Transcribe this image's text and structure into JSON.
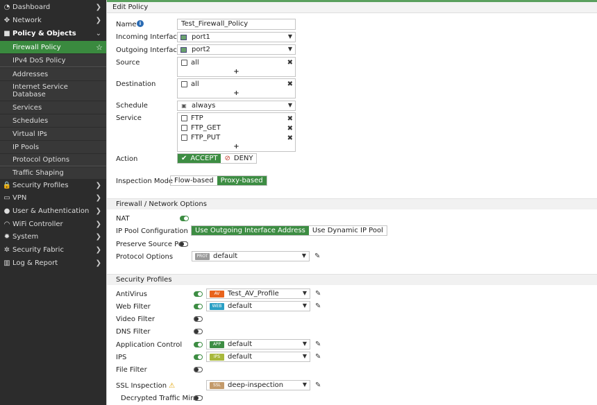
{
  "sidebar": {
    "items": [
      {
        "icon": "dashboard-icon",
        "glyph": "◔",
        "label": "Dashboard"
      },
      {
        "icon": "network-icon",
        "glyph": "✥",
        "label": "Network"
      },
      {
        "icon": "policy-icon",
        "glyph": "■",
        "label": "Policy & Objects"
      },
      {
        "icon": "security-profiles-icon",
        "glyph": "🔒",
        "label": "Security Profiles"
      },
      {
        "icon": "vpn-icon",
        "glyph": "▭",
        "label": "VPN"
      },
      {
        "icon": "user-icon",
        "glyph": "●",
        "label": "User & Authentication"
      },
      {
        "icon": "wifi-icon",
        "glyph": "◠",
        "label": "WiFi Controller"
      },
      {
        "icon": "system-icon",
        "glyph": "✹",
        "label": "System"
      },
      {
        "icon": "security-fabric-icon",
        "glyph": "✲",
        "label": "Security Fabric"
      },
      {
        "icon": "log-report-icon",
        "glyph": "▥",
        "label": "Log & Report"
      }
    ],
    "sub_items": [
      "Firewall Policy",
      "IPv4 DoS Policy",
      "Addresses",
      "Internet Service Database",
      "Services",
      "Schedules",
      "Virtual IPs",
      "IP Pools",
      "Protocol Options",
      "Traffic Shaping"
    ],
    "accent": "#3a8a3f"
  },
  "header": {
    "title": "Edit Policy"
  },
  "form": {
    "name_label": "Name",
    "name_value": "Test_Firewall_Policy",
    "incoming_label": "Incoming Interface",
    "incoming_value": "port1",
    "outgoing_label": "Outgoing Interface",
    "outgoing_value": "port2",
    "source_label": "Source",
    "source_value": "all",
    "destination_label": "Destination",
    "destination_value": "all",
    "schedule_label": "Schedule",
    "schedule_value": "always",
    "service_label": "Service",
    "services": [
      "FTP",
      "FTP_GET",
      "FTP_PUT"
    ],
    "action_label": "Action",
    "accept_label": "ACCEPT",
    "deny_label": "DENY",
    "inspection_label": "Inspection Mode",
    "flow_label": "Flow-based",
    "proxy_label": "Proxy-based"
  },
  "firewall": {
    "section_title": "Firewall / Network Options",
    "nat_label": "NAT",
    "ippool_label": "IP Pool Configuration",
    "use_outgoing_label": "Use Outgoing Interface Address",
    "use_dynamic_label": "Use Dynamic IP Pool",
    "preserve_label": "Preserve Source Port",
    "protocol_label": "Protocol Options",
    "protocol_badge": "PROT",
    "protocol_value": "default"
  },
  "profiles": {
    "section_title": "Security Profiles",
    "rows": [
      {
        "label": "AntiVirus",
        "on": true,
        "badge": "AV",
        "badge_color": "#e8631c",
        "value": "Test_AV_Profile"
      },
      {
        "label": "Web Filter",
        "on": true,
        "badge": "WEB",
        "badge_color": "#2b9fc4",
        "value": "default"
      },
      {
        "label": "Video Filter",
        "on": false
      },
      {
        "label": "DNS Filter",
        "on": false
      },
      {
        "label": "Application Control",
        "on": true,
        "badge": "APP",
        "badge_color": "#3d8d43",
        "value": "default"
      },
      {
        "label": "IPS",
        "on": true,
        "badge": "IPS",
        "badge_color": "#a8b83c",
        "value": "default"
      },
      {
        "label": "File Filter",
        "on": false
      }
    ],
    "ssl_label": "SSL Inspection",
    "ssl_badge": "SSL",
    "ssl_badge_color": "#c39a6a",
    "ssl_value": "deep-inspection",
    "mirror_label": "Decrypted Traffic Mirror"
  }
}
